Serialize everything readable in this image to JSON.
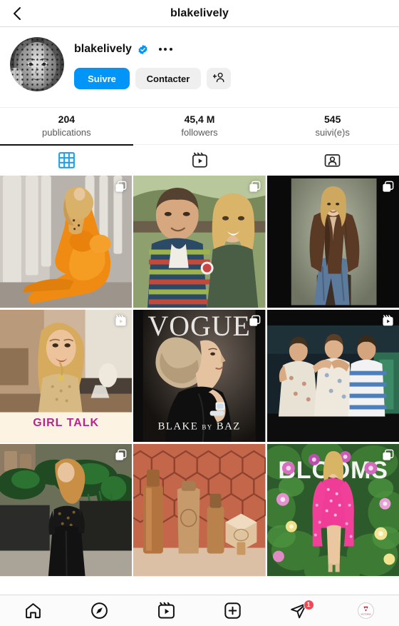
{
  "header": {
    "title": "blakelively",
    "back_icon": "chevron-left-icon"
  },
  "profile": {
    "username": "blakelively",
    "verified": true,
    "verified_icon": "verified-badge-icon",
    "more_icon": "more-options-icon",
    "avatar_alt": "blakelively-profile-photo",
    "buttons": {
      "follow": "Suivre",
      "message": "Contacter",
      "add_person_icon": "add-person-icon"
    }
  },
  "stats": [
    {
      "value": "204",
      "label": "publications",
      "name": "posts"
    },
    {
      "value": "45,4 M",
      "label": "followers",
      "name": "followers"
    },
    {
      "value": "545",
      "label": "suivi(e)s",
      "name": "following"
    }
  ],
  "tabs": [
    {
      "icon": "grid-icon",
      "name": "tab-grid",
      "active": true
    },
    {
      "icon": "reels-icon",
      "name": "tab-reels",
      "active": false
    },
    {
      "icon": "tagged-icon",
      "name": "tab-tagged",
      "active": false
    }
  ],
  "colors": {
    "accent_blue": "#0095f6",
    "tab_active": "#1fa1e8",
    "badge_red": "#ed4956",
    "text_primary": "#111111",
    "text_secondary": "#5a5a5a",
    "button_grey": "#efefef"
  },
  "grid_posts": [
    {
      "name": "post-orange-gown",
      "description": "Woman in voluminous orange gown beside white stone columns",
      "badge": "carousel-icon",
      "overlay_text": ""
    },
    {
      "name": "post-couple-selfie",
      "description": "Man in striped polo shirt and blonde woman smiling outdoors",
      "badge": "carousel-icon",
      "overlay_text": ""
    },
    {
      "name": "post-brown-coat",
      "description": "Woman in brown coat and blue jeans seated on stool, studio backdrop",
      "badge": "carousel-icon",
      "overlay_text": ""
    },
    {
      "name": "post-girl-talk",
      "description": "Blonde woman talking in warm-lit interior",
      "badge": "reels-icon",
      "overlay_text": "GIRL TALK"
    },
    {
      "name": "post-vogue-cover",
      "description": "Vogue magazine cover, woman in black gown with updo hairstyle",
      "badge": "carousel-icon",
      "overlay_text": "VOGUE",
      "overlay_text_2": "BLAKE BY BAZ"
    },
    {
      "name": "post-talk-show",
      "description": "Three people on stage at a talk show",
      "badge": "reels-icon",
      "overlay_text": ""
    },
    {
      "name": "post-black-outfit",
      "description": "Woman in black lace top and wide black trousers near greenery",
      "badge": "carousel-icon",
      "overlay_text": ""
    },
    {
      "name": "post-beauty-products",
      "description": "Copper-toned beauty product bottles against terracotta hexagon tiles",
      "badge": "",
      "overlay_text": ""
    },
    {
      "name": "post-pink-dress-blooms",
      "description": "Woman in hot pink sequin dress in front of green floral wall",
      "badge": "carousel-icon",
      "overlay_text": "BLOOMS"
    }
  ],
  "bottom_nav": [
    {
      "name": "nav-home",
      "icon": "home-icon",
      "badge": ""
    },
    {
      "name": "nav-explore",
      "icon": "compass-icon",
      "badge": ""
    },
    {
      "name": "nav-reels",
      "icon": "reels-icon",
      "badge": ""
    },
    {
      "name": "nav-create",
      "icon": "plus-square-icon",
      "badge": ""
    },
    {
      "name": "nav-activity",
      "icon": "paper-plane-icon",
      "badge": "1"
    },
    {
      "name": "nav-profile",
      "icon": "profile-avatar-icon",
      "badge": ""
    }
  ]
}
